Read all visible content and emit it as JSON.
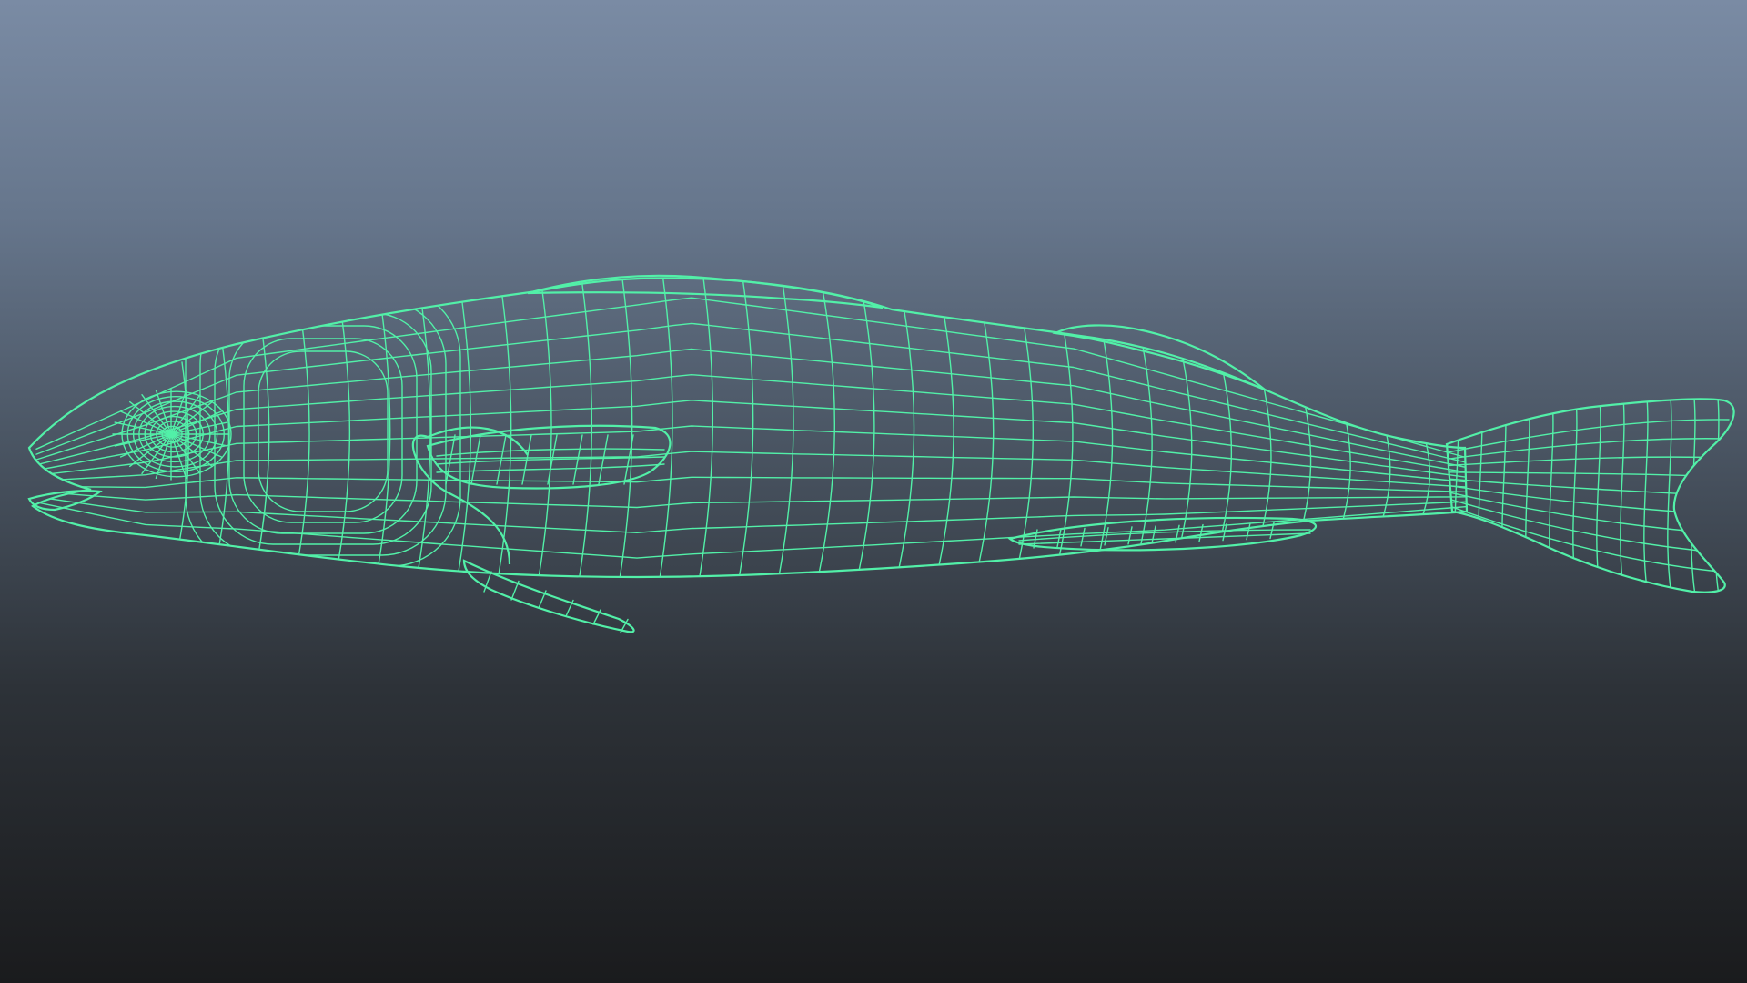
{
  "viewport": {
    "panel": "perspective-viewport",
    "background_top": "#7a8ba4",
    "background_bottom": "#1a1b1d"
  },
  "model": {
    "name": "fish-mesh",
    "display_mode": "wireframe-on-shaded",
    "selected": true,
    "wire_color": "#52f0a8",
    "surface_color": "#7c7c7c"
  }
}
